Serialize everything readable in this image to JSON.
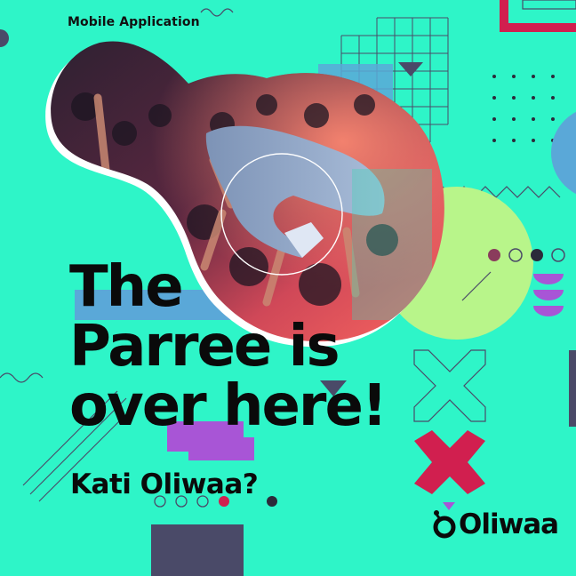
{
  "kicker": "Mobile Application",
  "headline": {
    "line1": "The",
    "line2": "Parree is",
    "line3": "over here!"
  },
  "tagline": "Kati Oliwaa?",
  "brand": {
    "name": "Oliwaa",
    "mark": "O"
  },
  "colors": {
    "background": "#2ef5c8",
    "ink": "#0c0c0c",
    "crimson": "#d11f4f",
    "purple": "#a855d6",
    "blue": "#5aa8d8",
    "lime": "#b8f58a",
    "slate": "#4a4a68"
  },
  "icons": [
    "brand-logo-icon",
    "cross-icon",
    "triangle-icon",
    "semicircle-stack-icon",
    "dot-row-icon"
  ]
}
